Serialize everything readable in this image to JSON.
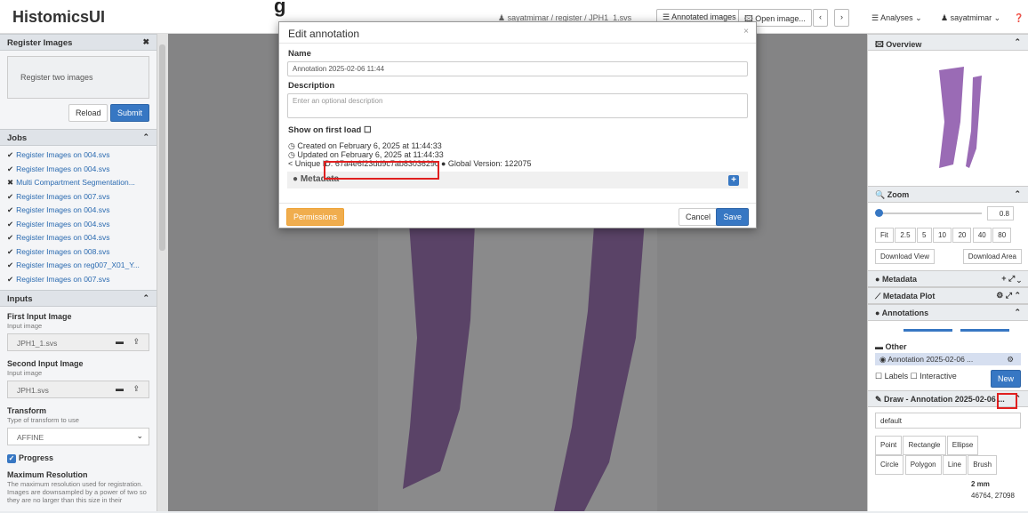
{
  "app": {
    "title": "HistomicsUI",
    "cut_title": "g"
  },
  "topbar": {
    "breadcrumb": "♟ sayatmimar / register / JPH1_1.svs",
    "annotated_images": "☰ Annotated images",
    "open_image": "🖾 Open image...",
    "prev": "‹",
    "next": "›",
    "analyses": "☰ Analyses ⌄",
    "user": "♟ sayatmimar ⌄",
    "help": "❓"
  },
  "left": {
    "register_header": "Register Images",
    "register_close": "✖",
    "register_desc": "Register two images",
    "reload": "Reload",
    "submit": "Submit",
    "jobs_header": "Jobs",
    "jobs": [
      {
        "mark": "✔",
        "label": "Register Images on 004.svs"
      },
      {
        "mark": "✔",
        "label": "Register Images on 004.svs"
      },
      {
        "mark": "✖",
        "label": "Multi Compartment Segmentation..."
      },
      {
        "mark": "✔",
        "label": "Register Images on 007.svs"
      },
      {
        "mark": "✔",
        "label": "Register Images on 004.svs"
      },
      {
        "mark": "✔",
        "label": "Register Images on 004.svs"
      },
      {
        "mark": "✔",
        "label": "Register Images on 004.svs"
      },
      {
        "mark": "✔",
        "label": "Register Images on 008.svs"
      },
      {
        "mark": "✔",
        "label": "Register Images on reg007_X01_Y..."
      },
      {
        "mark": "✔",
        "label": "Register Images on 007.svs"
      }
    ],
    "inputs_header": "Inputs",
    "first_label": "First Input Image",
    "first_sub": "Input image",
    "first_value": "JPH1_1.svs",
    "second_label": "Second Input Image",
    "second_sub": "Input image",
    "second_value": "JPH1.svs",
    "transform_label": "Transform",
    "transform_sub": "Type of transform to use",
    "transform_value": "AFFINE",
    "progress_label": "Progress",
    "maxres_label": "Maximum Resolution",
    "maxres_desc": "The maximum resolution used for registration. Images are downsampled by a power of two so they are no larger than this size in their"
  },
  "modal": {
    "title": "Edit annotation",
    "close": "×",
    "name_label": "Name",
    "name_value": "Annotation 2025-02-06 11:44",
    "desc_label": "Description",
    "desc_placeholder": "Enter an optional description",
    "show_first_load": "Show on first load",
    "created": "Created on February 6, 2025 at 11:44:33",
    "updated": "Updated on February 6, 2025 at 11:44:33",
    "unique_id_label": "Unique ID:",
    "unique_id": "67a4e6f23dd9c7ab8303629c",
    "global_version": "Global Version: 122075",
    "metadata": "Metadata",
    "permissions": "Permissions",
    "cancel": "Cancel",
    "save": "Save"
  },
  "right": {
    "overview": "Overview",
    "zoom": "Zoom",
    "zoom_value": "0.8",
    "zoom_levels": [
      "Fit",
      "2.5",
      "5",
      "10",
      "20",
      "40",
      "80"
    ],
    "download_view": "Download View",
    "download_area": "Download Area",
    "metadata": "Metadata",
    "metadata_plot": "Metadata Plot",
    "annotations": "Annotations",
    "other": "Other",
    "annotation_item": "Annotation 2025-02-06 ...",
    "labels": "Labels",
    "interactive": "Interactive",
    "new": "New",
    "draw": "Draw - Annotation 2025-02-06 ...",
    "style": "default",
    "tools": [
      "Point",
      "Rectangle",
      "Ellipse",
      "Circle",
      "Polygon",
      "Line",
      "Brush"
    ],
    "scale": "2 mm",
    "coords": "46764, 27098"
  },
  "colors": {
    "accent": "#3777c3",
    "warning": "#f0ad4e",
    "highlight": "#e02020",
    "tissue": "#9a6bb5"
  }
}
